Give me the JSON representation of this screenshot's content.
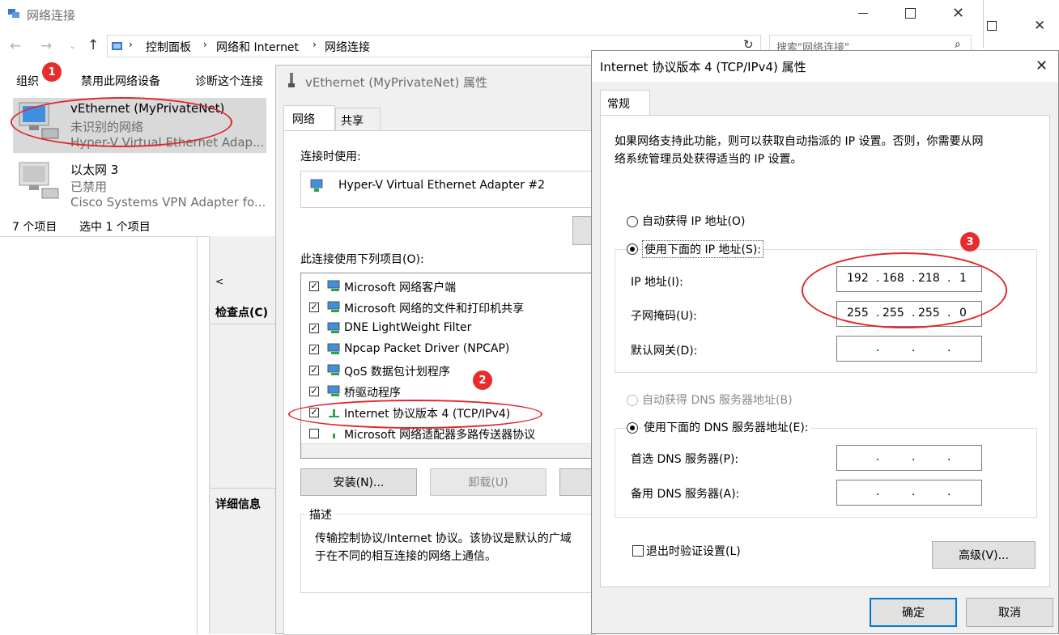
{
  "explorer": {
    "title": "网络连接",
    "breadcrumb": [
      "控制面板",
      "网络和 Internet",
      "网络连接"
    ],
    "search_placeholder": "搜索\"网络连接\"",
    "toolbar": {
      "organize": "组织",
      "disable": "禁用此网络设备",
      "diagnose": "诊断这个连接"
    },
    "items": [
      {
        "name": "vEthernet (MyPrivateNet)",
        "status": "未识别的网络",
        "device": "Hyper-V Virtual Ethernet Adap..."
      },
      {
        "name": "以太网 3",
        "status": "已禁用",
        "device": "Cisco Systems VPN Adapter fo..."
      }
    ],
    "status_count": "7 个项目",
    "status_selected": "选中 1 个项目",
    "side_labels": {
      "checkpoint": "检查点(C)",
      "details": "详细信息"
    },
    "scroll_left": "<"
  },
  "props": {
    "title": "vEthernet (MyPrivateNet) 属性",
    "tabs": [
      "网络",
      "共享"
    ],
    "connect_using_label": "连接时使用:",
    "adapter": "Hyper-V Virtual Ethernet Adapter #2",
    "items_label": "此连接使用下列项目(O):",
    "components": [
      {
        "label": "Microsoft 网络客户端",
        "checked": true
      },
      {
        "label": "Microsoft 网络的文件和打印机共享",
        "checked": true
      },
      {
        "label": "DNE LightWeight Filter",
        "checked": true
      },
      {
        "label": "Npcap Packet Driver (NPCAP)",
        "checked": true
      },
      {
        "label": "QoS 数据包计划程序",
        "checked": true
      },
      {
        "label": "桥驱动程序",
        "checked": true
      },
      {
        "label": "Internet 协议版本 4 (TCP/IPv4)",
        "checked": true
      },
      {
        "label": "Microsoft 网络适配器多路传送器协议",
        "checked": false
      }
    ],
    "install": "安装(N)...",
    "uninstall": "卸载(U)",
    "desc_title": "描述",
    "desc_line1": "传输控制协议/Internet 协议。该协议是默认的广域",
    "desc_line2": "于在不同的相互连接的网络上通信。"
  },
  "ipv4": {
    "title": "Internet 协议版本 4 (TCP/IPv4) 属性",
    "tab": "常规",
    "intro_line1": "如果网络支持此功能，则可以获取自动指派的 IP 设置。否则，你需要从网",
    "intro_line2": "络系统管理员处获得适当的 IP 设置。",
    "auto_ip": "自动获得 IP 地址(O)",
    "manual_ip": "使用下面的 IP 地址(S):",
    "ip_label": "IP 地址(I):",
    "ip": [
      "192",
      "168",
      "218",
      "1"
    ],
    "mask_label": "子网掩码(U):",
    "mask": [
      "255",
      "255",
      "255",
      "0"
    ],
    "gateway_label": "默认网关(D):",
    "auto_dns": "自动获得 DNS 服务器地址(B)",
    "manual_dns": "使用下面的 DNS 服务器地址(E):",
    "dns1_label": "首选 DNS 服务器(P):",
    "dns2_label": "备用 DNS 服务器(A):",
    "validate": "退出时验证设置(L)",
    "advanced": "高级(V)...",
    "ok": "确定",
    "cancel": "取消"
  },
  "badges": [
    "1",
    "2",
    "3"
  ],
  "colors": {
    "annotation_red": "#e0262b",
    "selection": "#cce8ff",
    "accent": "#0078d7"
  }
}
